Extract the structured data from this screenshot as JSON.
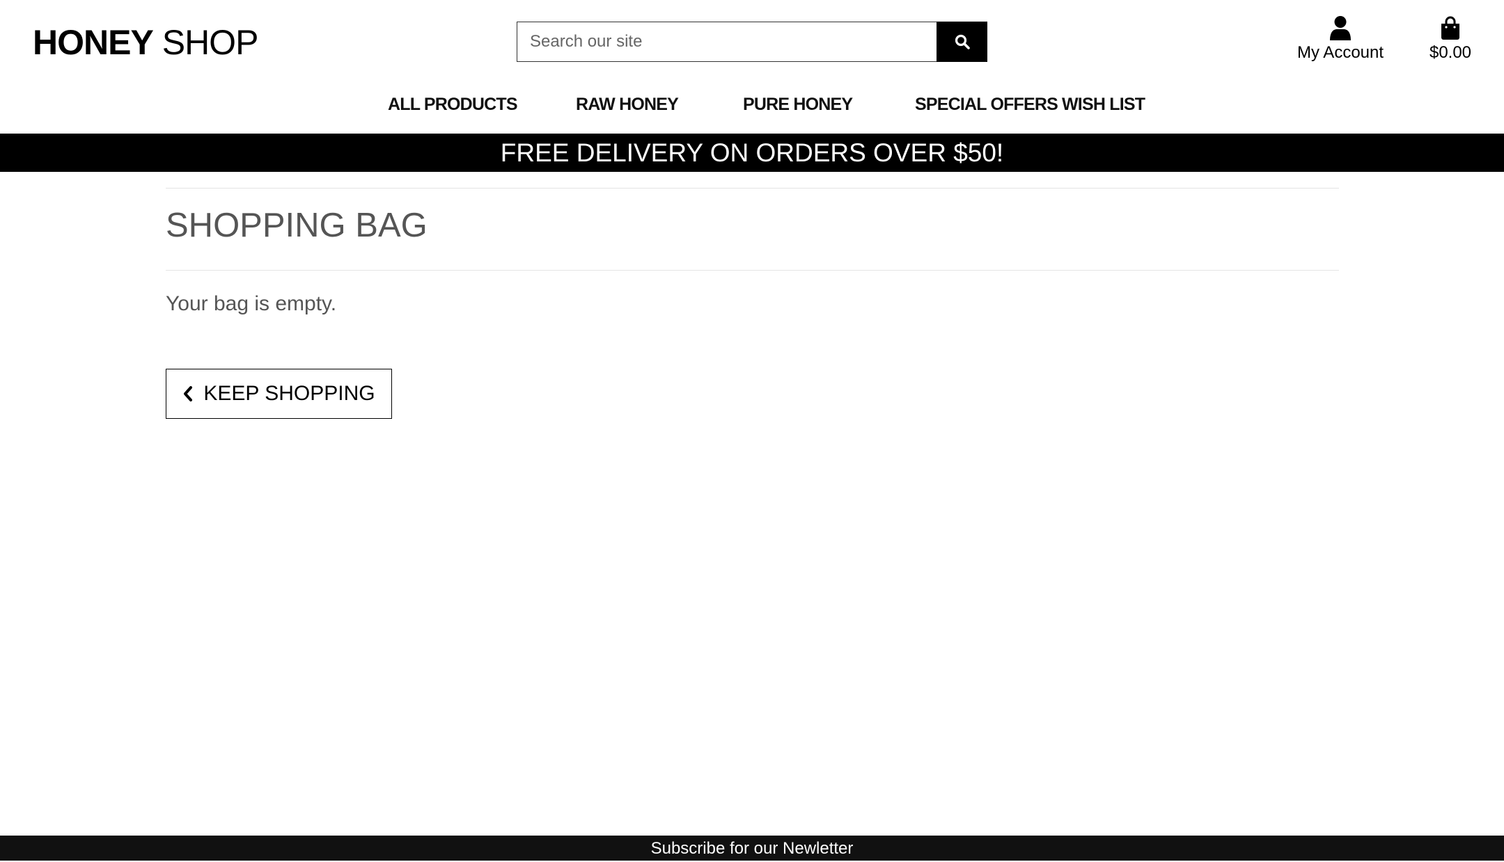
{
  "header": {
    "logo": {
      "bold": "HONEY",
      "light": "SHOP"
    },
    "search": {
      "placeholder": "Search our site",
      "value": ""
    },
    "account": {
      "label": "My Account",
      "icon": "user-icon"
    },
    "bag": {
      "total": "$0.00",
      "icon": "shopping-bag-icon"
    }
  },
  "nav": {
    "items": [
      {
        "label": "ALL PRODUCTS"
      },
      {
        "label": "RAW HONEY"
      },
      {
        "label": "PURE HONEY"
      },
      {
        "label": "SPECIAL OFFERS"
      },
      {
        "label": "WISH LIST"
      }
    ]
  },
  "banner": {
    "text": "FREE DELIVERY ON ORDERS OVER $50!"
  },
  "main": {
    "title": "SHOPPING BAG",
    "empty_message": "Your bag is empty.",
    "keep_shopping": {
      "label": "KEEP SHOPPING",
      "icon": "chevron-left-icon"
    }
  },
  "footer": {
    "text": "Subscribe for our Newletter"
  },
  "colors": {
    "banner_bg": "#000000",
    "footer_bg": "#111111",
    "title_text": "#555555"
  }
}
